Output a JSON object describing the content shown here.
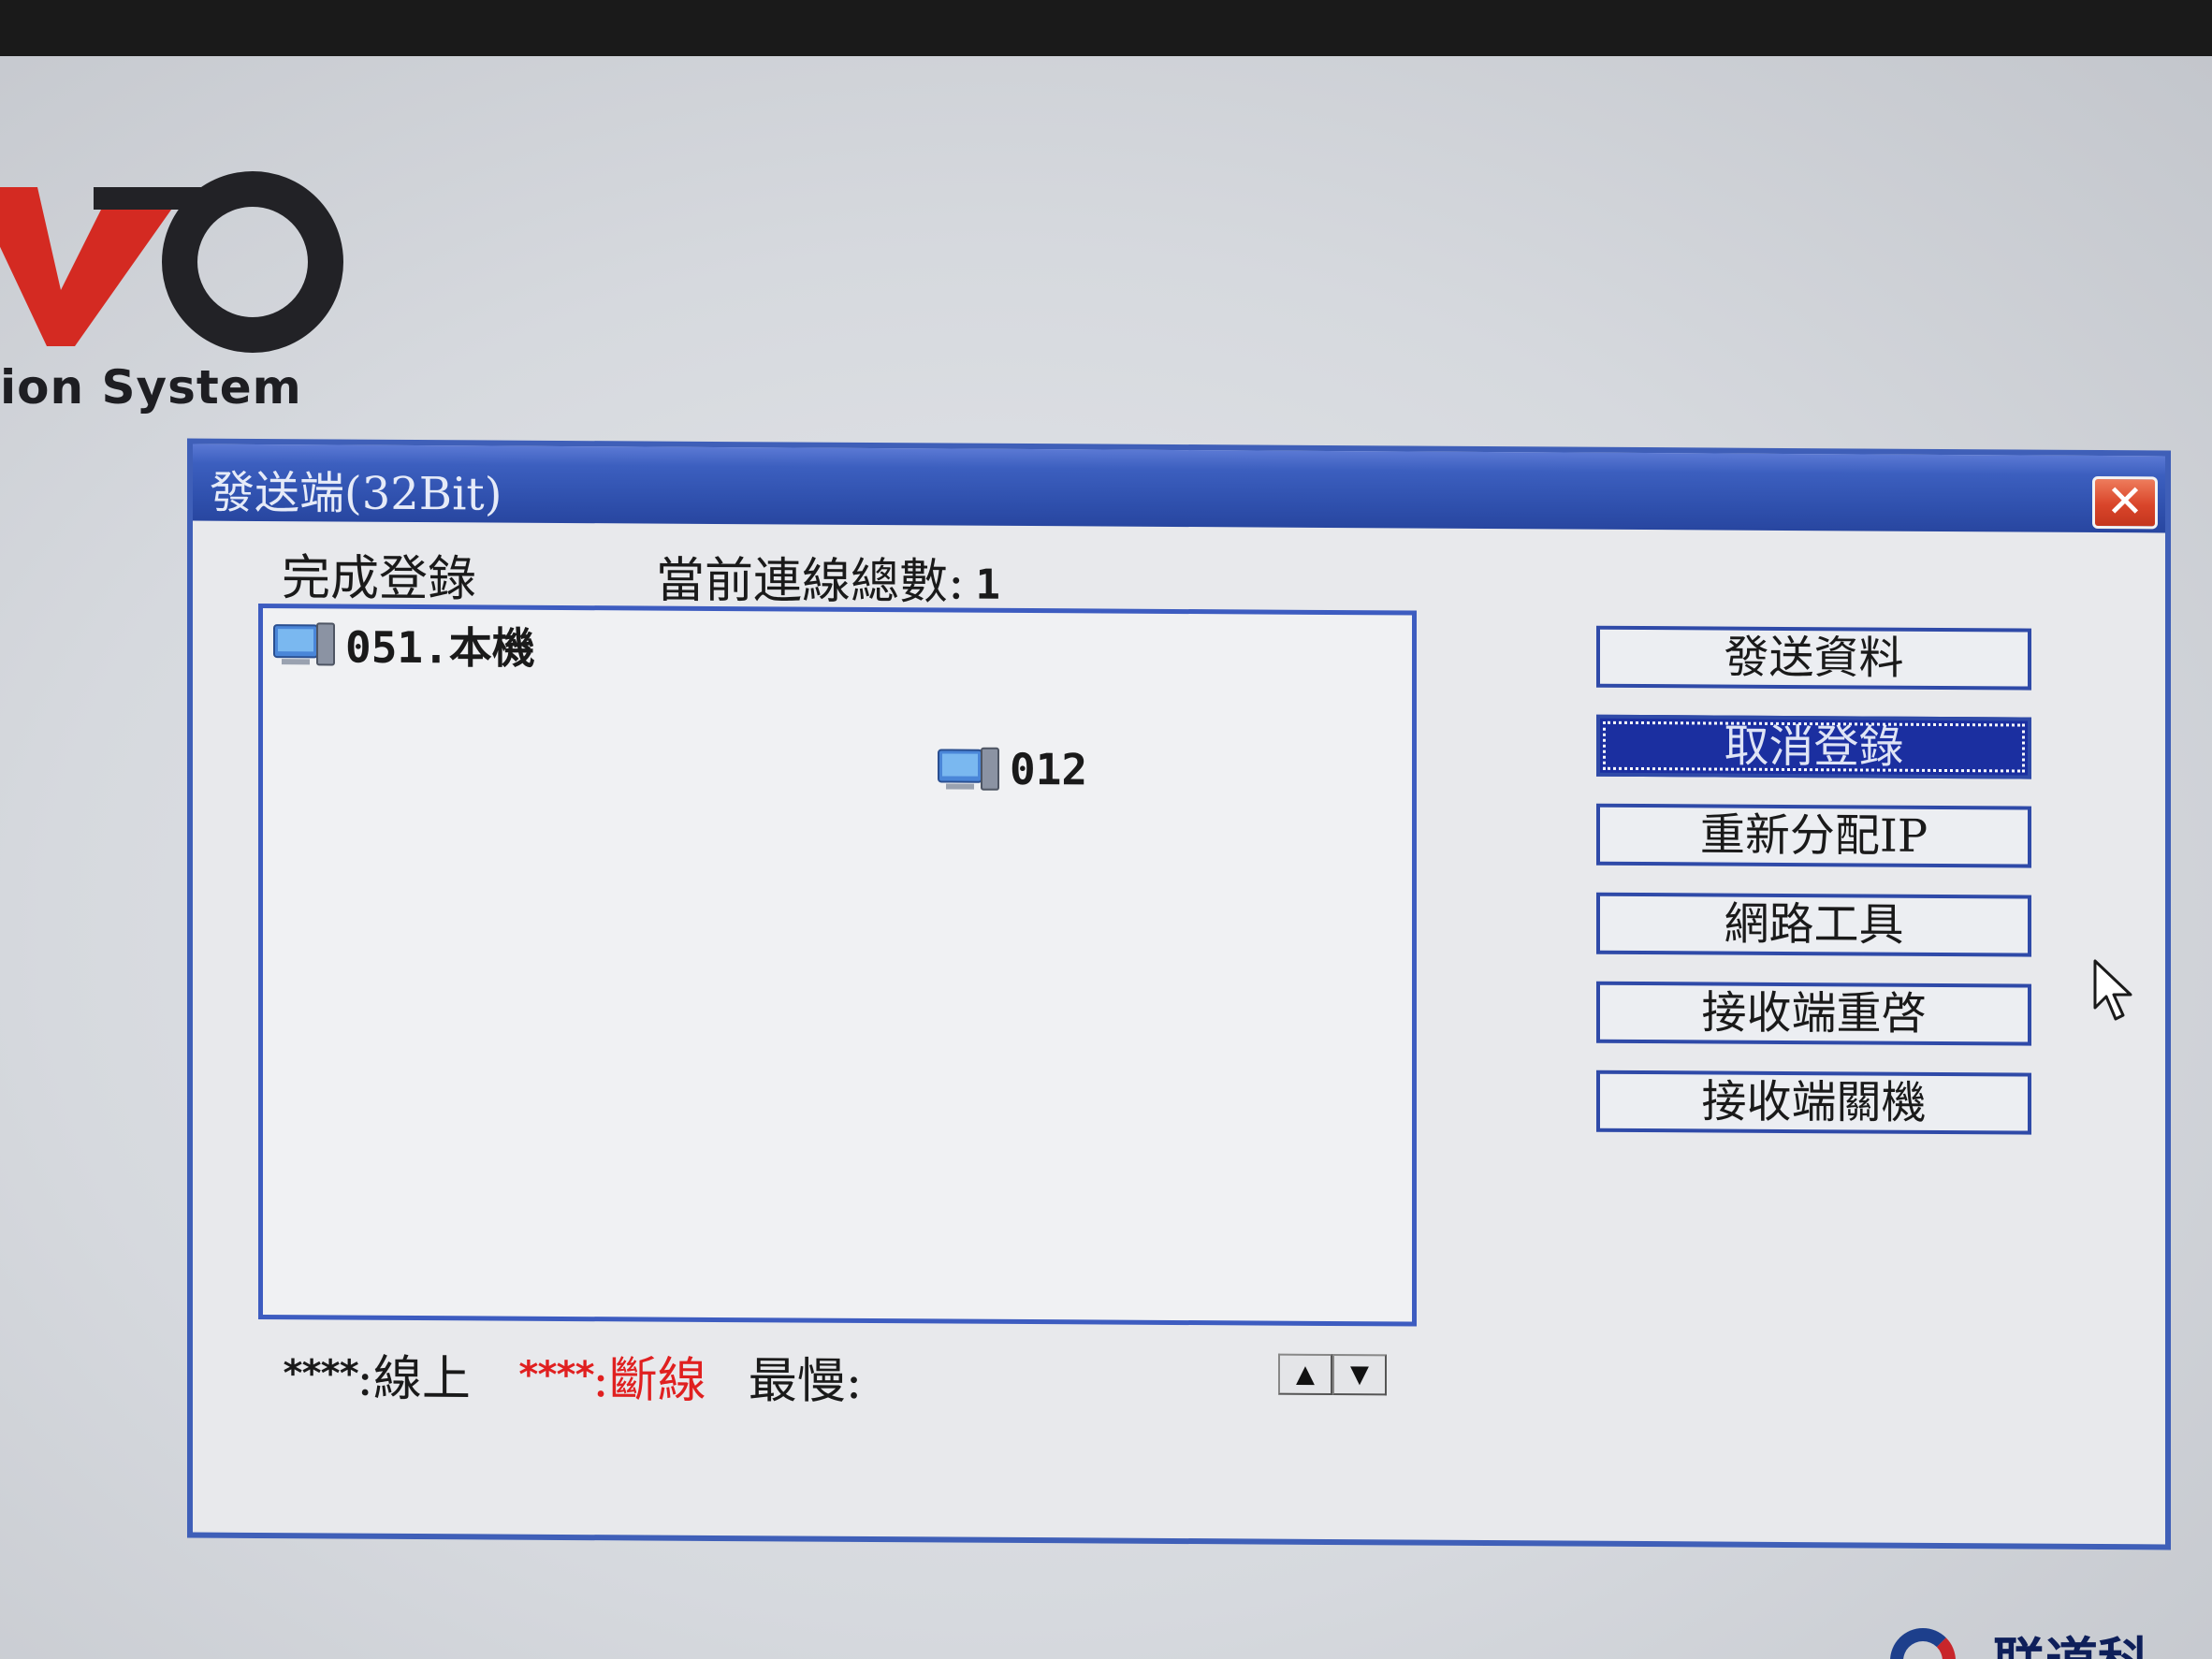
{
  "background": {
    "brand_text": "ion System",
    "bottom_brand_text": "联道科"
  },
  "window": {
    "title": "發送端(32Bit)",
    "close_label": "✕",
    "status_text": "完成登錄",
    "connection_label": "當前連線總數:",
    "connection_count": "1"
  },
  "clients": [
    {
      "label": "051.本機",
      "icon": "computer-icon"
    },
    {
      "label": "012",
      "icon": "computer-icon"
    }
  ],
  "buttons": [
    {
      "label": "發送資料",
      "selected": false
    },
    {
      "label": "取消登錄",
      "selected": true
    },
    {
      "label": "重新分配IP",
      "selected": false
    },
    {
      "label": "網路工具",
      "selected": false
    },
    {
      "label": "接收端重啓",
      "selected": false
    },
    {
      "label": "接收端關機",
      "selected": false
    }
  ],
  "legend": {
    "online_marker": "****",
    "online_label": ":線上",
    "offline_marker": "****",
    "offline_label": ":斷線",
    "speed_label": "最慢:"
  },
  "spinner": {
    "up": "▲",
    "down": "▼"
  },
  "colors": {
    "title_bar": "#2f50ad",
    "border": "#3d5cc0",
    "offline": "#e02020",
    "selected_button": "#1b2fa0"
  }
}
